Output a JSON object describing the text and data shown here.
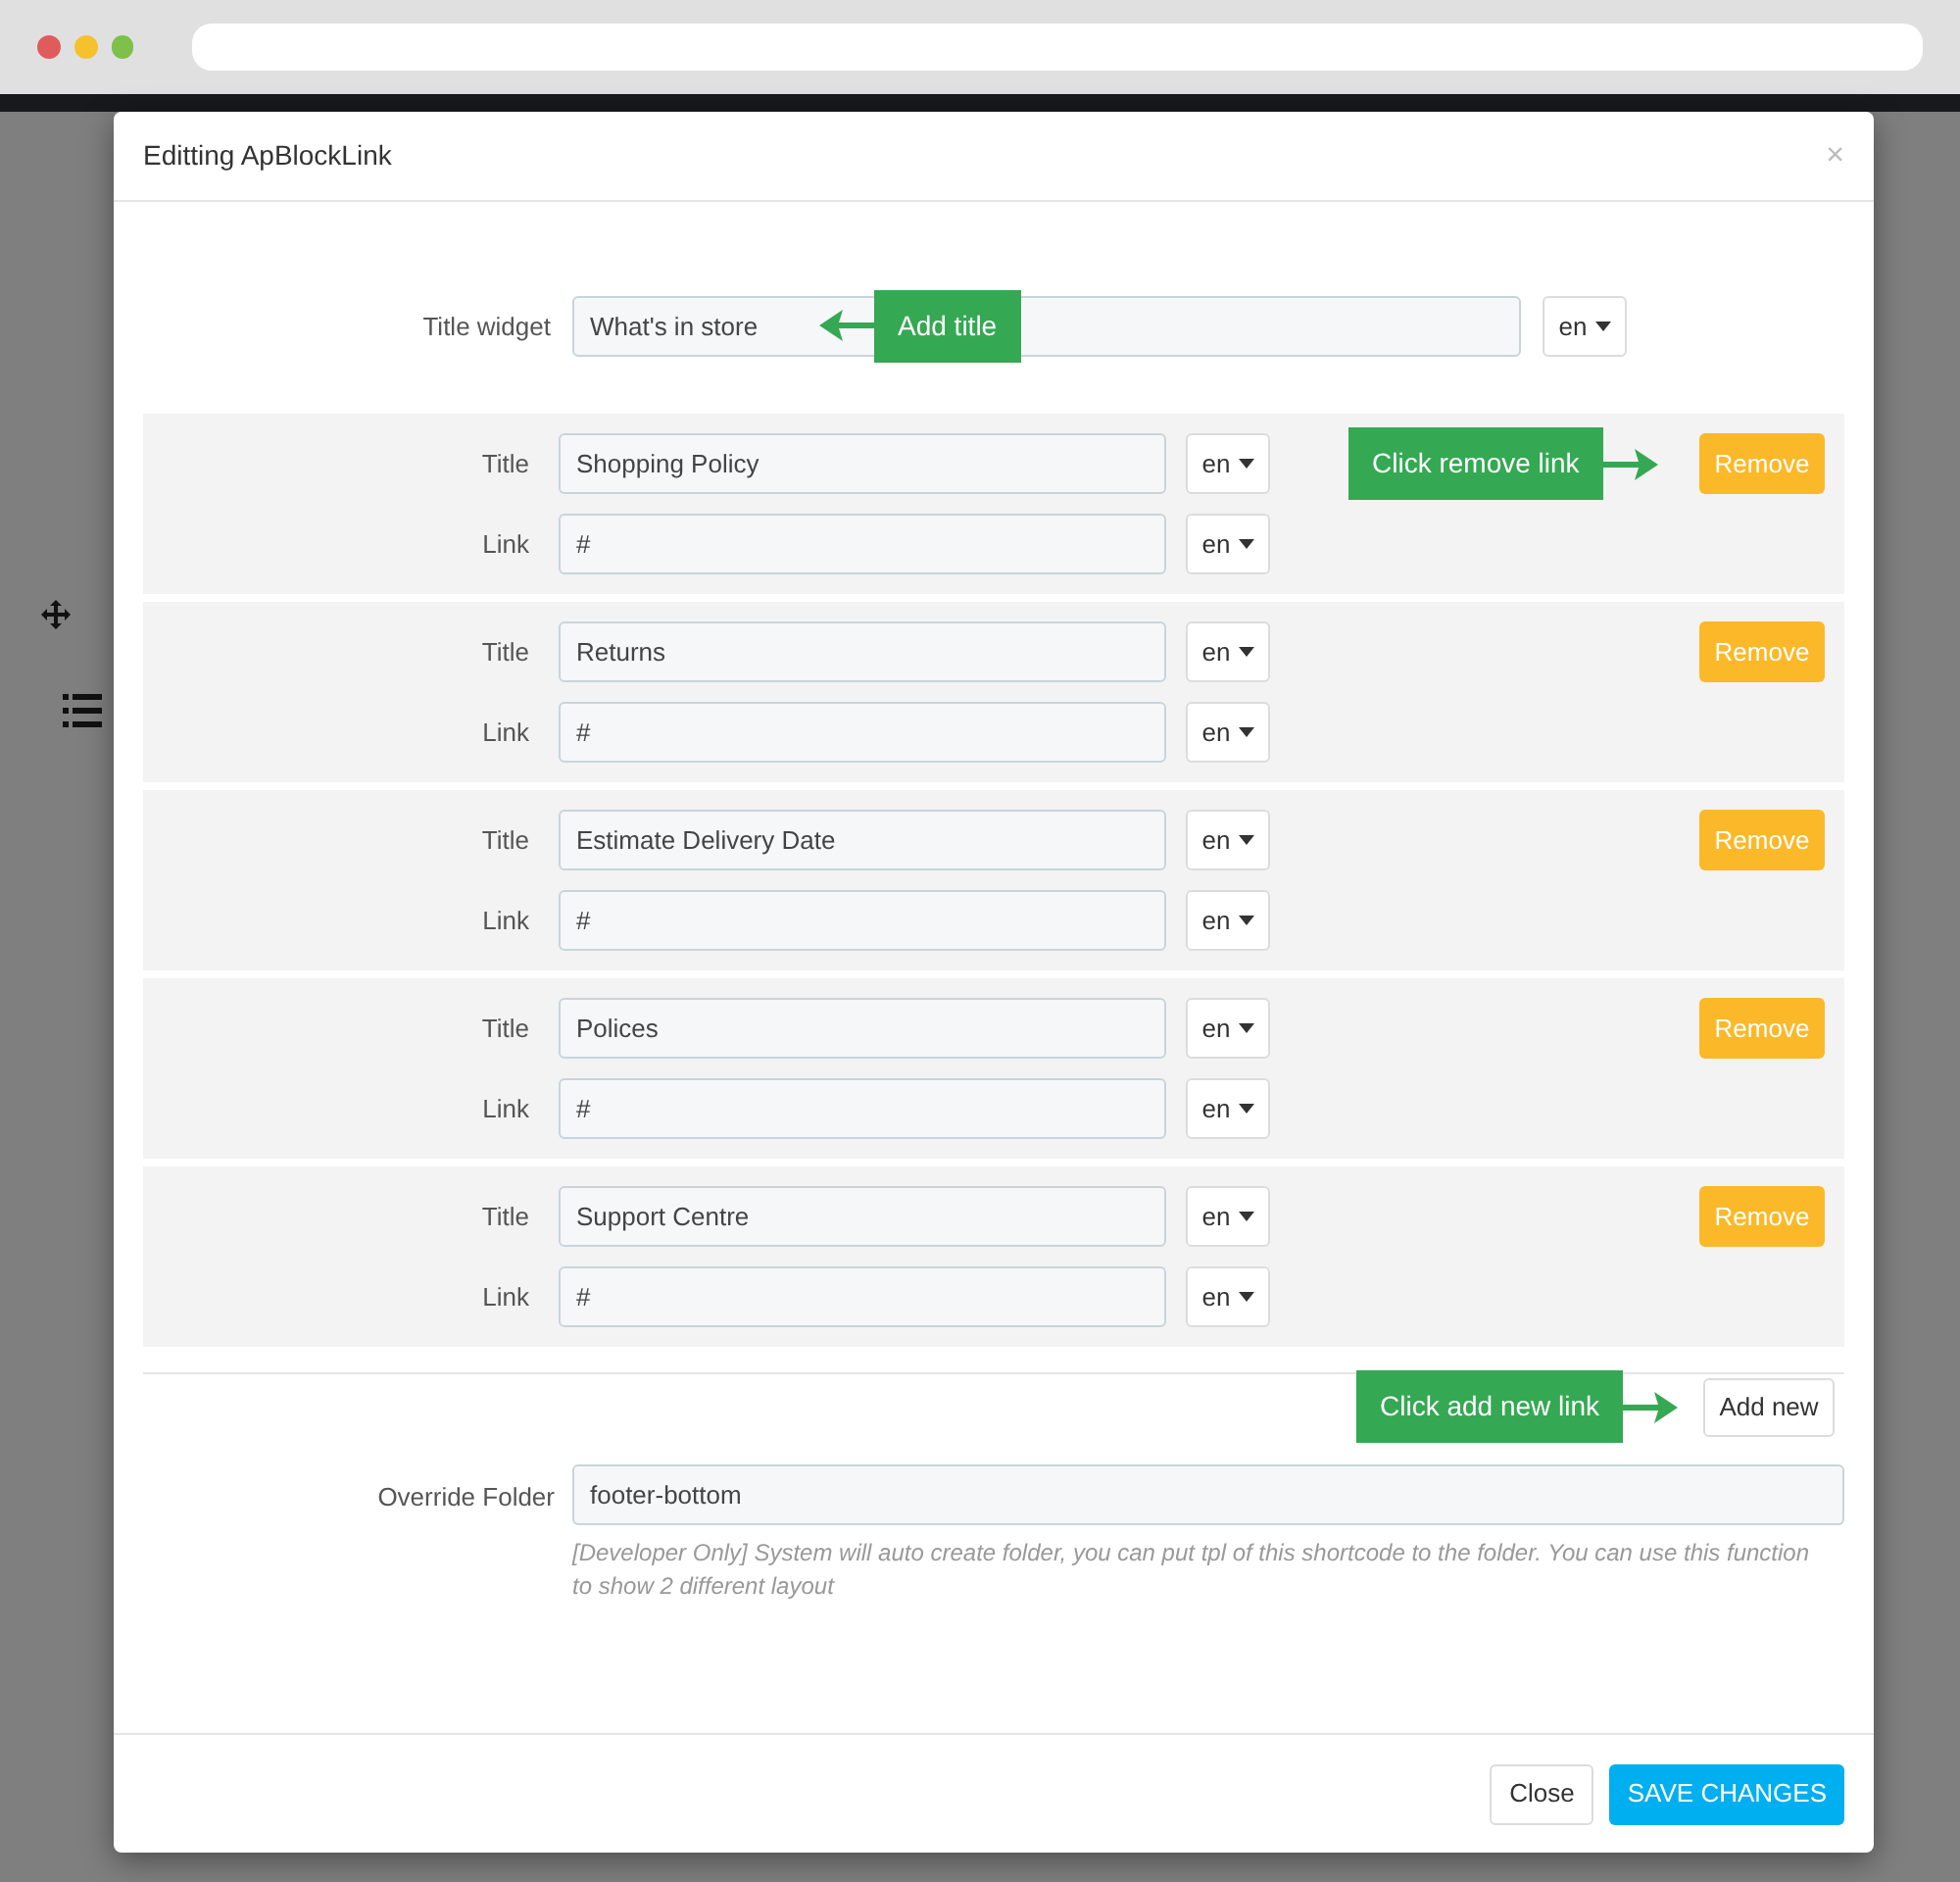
{
  "modal": {
    "title": "Editting ApBlockLink",
    "close": "×"
  },
  "title_widget": {
    "label": "Title widget",
    "value": "What's in store",
    "lang": "en",
    "callout": "Add title"
  },
  "links": [
    {
      "title_label": "Title",
      "title_value": "Shopping Policy",
      "title_lang": "en",
      "link_label": "Link",
      "link_value": "#",
      "link_lang": "en",
      "remove": "Remove",
      "callout": "Click remove link"
    },
    {
      "title_label": "Title",
      "title_value": "Returns",
      "title_lang": "en",
      "link_label": "Link",
      "link_value": "#",
      "link_lang": "en",
      "remove": "Remove"
    },
    {
      "title_label": "Title",
      "title_value": "Estimate Delivery Date",
      "title_lang": "en",
      "link_label": "Link",
      "link_value": "#",
      "link_lang": "en",
      "remove": "Remove"
    },
    {
      "title_label": "Title",
      "title_value": "Polices",
      "title_lang": "en",
      "link_label": "Link",
      "link_value": "#",
      "link_lang": "en",
      "remove": "Remove"
    },
    {
      "title_label": "Title",
      "title_value": "Support Centre",
      "title_lang": "en",
      "link_label": "Link",
      "link_value": "#",
      "link_lang": "en",
      "remove": "Remove"
    }
  ],
  "add_new": {
    "label": "Add new",
    "callout": "Click add new link"
  },
  "override_folder": {
    "label": "Override Folder",
    "value": "footer-bottom",
    "help": "[Developer Only] System will auto create folder, you can put tpl of this shortcode to the folder. You can use this function to show 2 different layout"
  },
  "footer": {
    "close": "Close",
    "save": "SAVE CHANGES"
  }
}
